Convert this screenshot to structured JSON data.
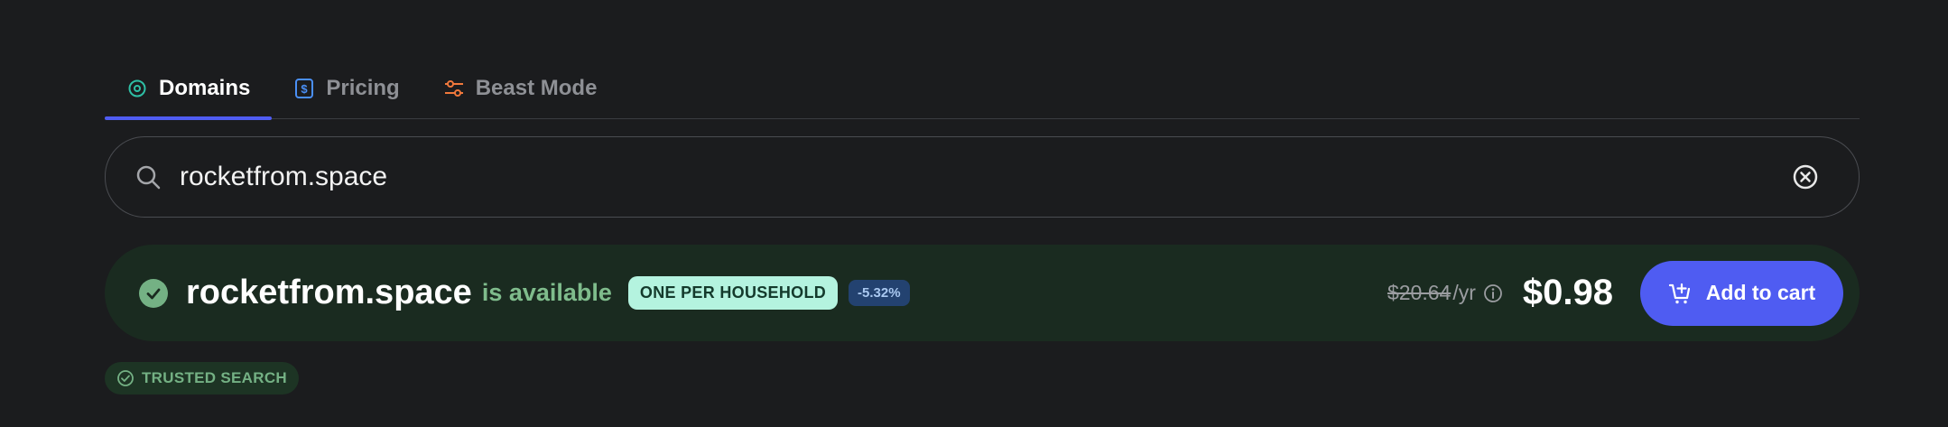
{
  "tabs": [
    {
      "label": "Domains",
      "icon": "target-icon",
      "active": true
    },
    {
      "label": "Pricing",
      "icon": "dollar-tag-icon",
      "active": false
    },
    {
      "label": "Beast Mode",
      "icon": "sliders-icon",
      "active": false
    }
  ],
  "search": {
    "value": "rocketfrom.space",
    "placeholder": ""
  },
  "result": {
    "domain": "rocketfrom.space",
    "status_text": "is available",
    "badge_household": "ONE PER HOUSEHOLD",
    "badge_discount": "-5.32%",
    "old_price": "$20.64",
    "per_year": "/yr",
    "price": "$0.98",
    "add_to_cart_label": "Add to cart"
  },
  "trusted_label": "TRUSTED SEARCH",
  "colors": {
    "accent": "#4f5cf2",
    "available_green": "#74b184",
    "background": "#1b1c1e"
  }
}
